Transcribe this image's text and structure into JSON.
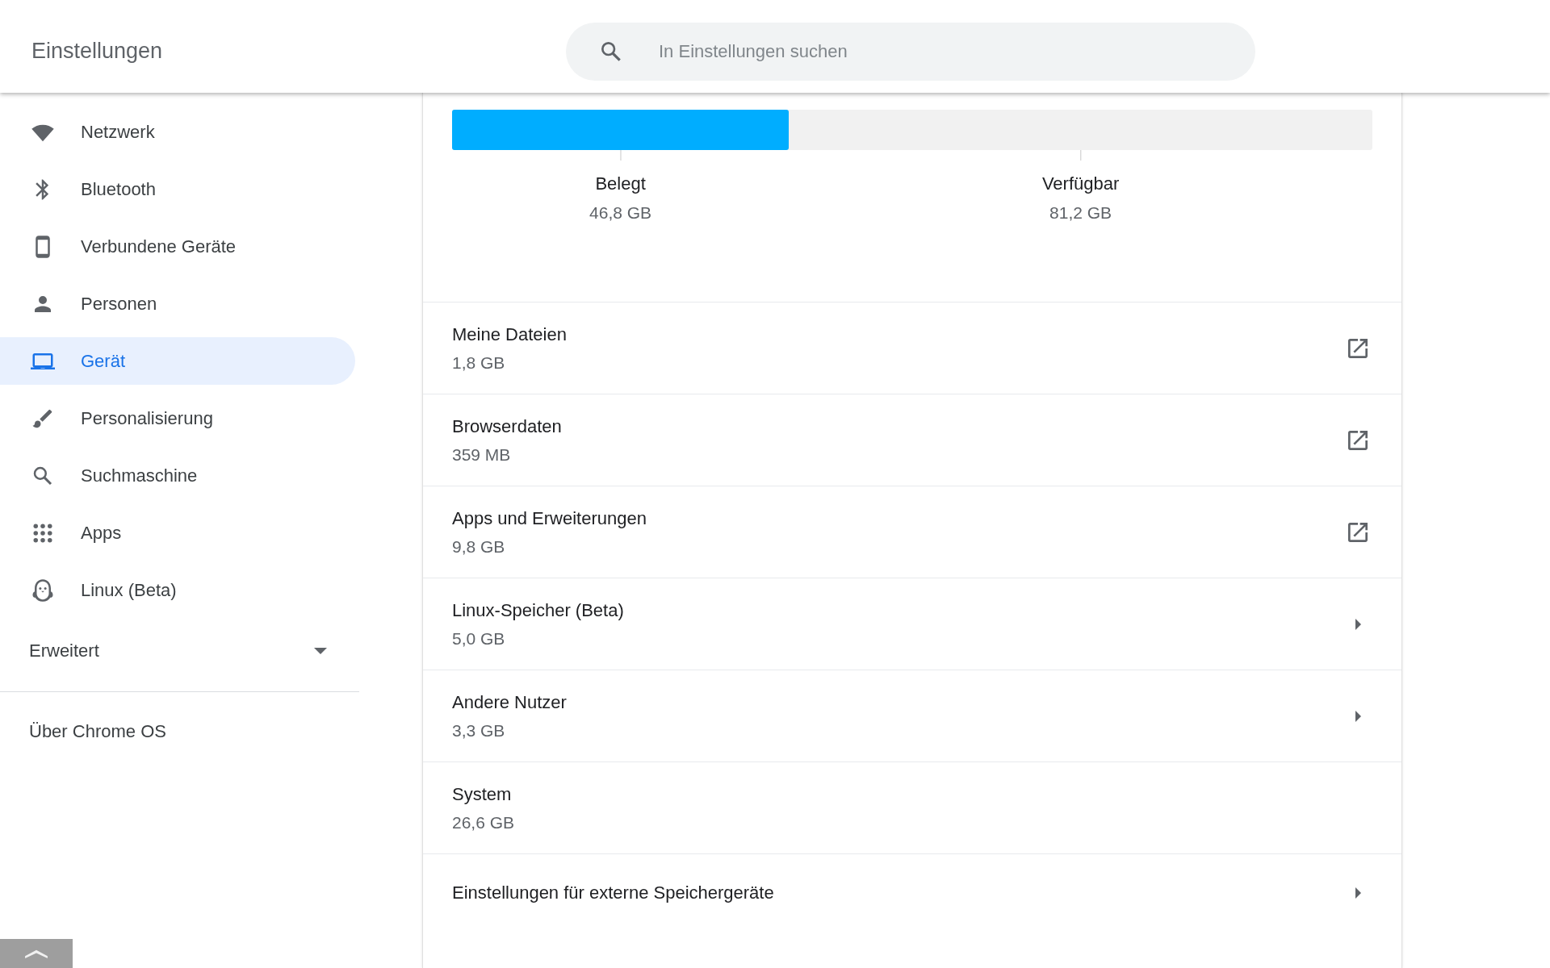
{
  "header": {
    "title": "Einstellungen",
    "search": {
      "placeholder": "In Einstellungen suchen"
    }
  },
  "sidebar": {
    "items": [
      {
        "label": "Netzwerk",
        "selected": false
      },
      {
        "label": "Bluetooth",
        "selected": false
      },
      {
        "label": "Verbundene Geräte",
        "selected": false
      },
      {
        "label": "Personen",
        "selected": false
      },
      {
        "label": "Gerät",
        "selected": true
      },
      {
        "label": "Personalisierung",
        "selected": false
      },
      {
        "label": "Suchmaschine",
        "selected": false
      },
      {
        "label": "Apps",
        "selected": false
      },
      {
        "label": "Linux (Beta)",
        "selected": false
      }
    ],
    "advanced": {
      "label": "Erweitert",
      "expanded": false
    },
    "about": "Über Chrome OS"
  },
  "storage": {
    "level": 0.366,
    "used": {
      "label": "Belegt",
      "value": "46,8 GB"
    },
    "available": {
      "label": "Verfügbar",
      "value": "81,2 GB"
    }
  },
  "rows": [
    {
      "title": "Meine Dateien",
      "size": "1,8 GB",
      "kind": "external"
    },
    {
      "title": "Browserdaten",
      "size": "359 MB",
      "kind": "external"
    },
    {
      "title": "Apps und Erweiterungen",
      "size": "9,8 GB",
      "kind": "external"
    },
    {
      "title": "Linux-Speicher (Beta)",
      "size": "5,0 GB",
      "kind": "submenu"
    },
    {
      "title": "Andere Nutzer",
      "size": "3,3 GB",
      "kind": "submenu"
    },
    {
      "title": "System",
      "size": "26,6 GB",
      "kind": "plain"
    },
    {
      "title": "Einstellungen für externe Speichergeräte",
      "kind": "submenu"
    }
  ]
}
